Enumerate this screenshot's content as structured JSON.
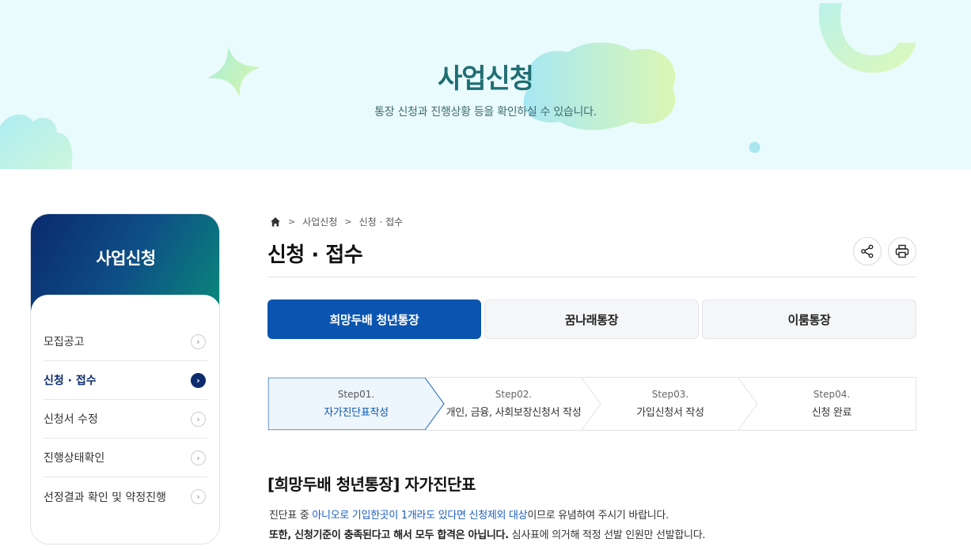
{
  "hero": {
    "title": "사업신청",
    "subtitle": "통장 신청과 진행상황 등을 확인하실 수 있습니다."
  },
  "sidebar": {
    "title": "사업신청",
    "items": [
      {
        "label": "모집공고",
        "active": false
      },
      {
        "label": "신청 · 접수",
        "active": true
      },
      {
        "label": "신청서 수정",
        "active": false
      },
      {
        "label": "진행상태확인",
        "active": false
      },
      {
        "label": "선정결과 확인 및 약정진행",
        "active": false
      }
    ]
  },
  "breadcrumb": {
    "home_icon": "home-icon",
    "items": [
      "사업신청",
      "신청 · 접수"
    ]
  },
  "page": {
    "title": "신청 · 접수",
    "share_icon": "share-icon",
    "print_icon": "print-icon"
  },
  "tabs": [
    {
      "label": "희망두배 청년통장",
      "active": true
    },
    {
      "label": "꿈나래통장",
      "active": false
    },
    {
      "label": "이룸통장",
      "active": false
    }
  ],
  "steps": [
    {
      "num": "Step01.",
      "label": "자가진단표작성",
      "active": true
    },
    {
      "num": "Step02.",
      "label": "개인, 금융, 사회보장신청서 작성",
      "active": false
    },
    {
      "num": "Step03.",
      "label": "가입신청서 작성",
      "active": false
    },
    {
      "num": "Step04.",
      "label": "신청 완료",
      "active": false
    }
  ],
  "content": {
    "section_title": "[희망두배 청년통장] 자가진단표",
    "line1_pre": "진단표 중 ",
    "line1_hl1": "아니오로 기입한곳이 1개라도 있다면",
    "line1_sp": " ",
    "line1_hl2": "신청제외 대상",
    "line1_post": "이므로 유념하여 주시기 바랍니다.",
    "line2_bold": "또한, 신청기준이 충족된다고 해서 모두 합격은 아닙니다.",
    "line2_post": " 심사표에 의거해 적정 선발 인원만 선발합니다."
  },
  "colors": {
    "accent": "#0b55b0",
    "navy": "#0d2b6e",
    "hero_bg": "#eafbfd",
    "hero_title": "#1f6e73"
  }
}
